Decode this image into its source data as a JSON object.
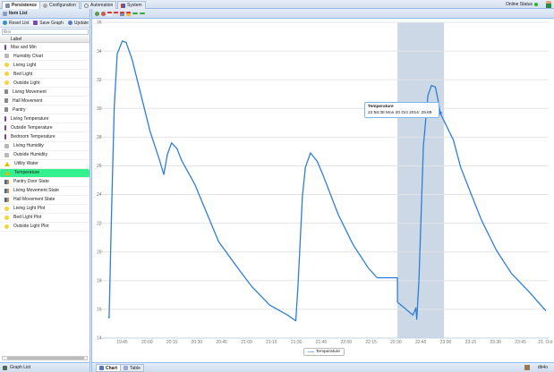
{
  "top_tabs": [
    {
      "label": "Persistence",
      "icon": "persistence-icon",
      "active": true
    },
    {
      "label": "Configuration",
      "icon": "gear-icon",
      "active": false
    },
    {
      "label": "Automation",
      "icon": "clock-icon",
      "active": false
    },
    {
      "label": "System",
      "icon": "system-icon",
      "active": false
    }
  ],
  "status": {
    "label": "Online Status",
    "color": "#22bb22"
  },
  "left_panel": {
    "title": "Item List",
    "toolbar": {
      "reset": "Reset List",
      "save": "Save Graph",
      "update": "Update"
    },
    "filter_placeholder": "filter",
    "column_header": "Label",
    "items": [
      {
        "label": "Max and Min",
        "icon": "thermo"
      },
      {
        "label": "Humidity Chart",
        "icon": "chart"
      },
      {
        "label": "Living Light",
        "icon": "bulb"
      },
      {
        "label": "Bed Light",
        "icon": "bulb"
      },
      {
        "label": "Outside Light",
        "icon": "bulb"
      },
      {
        "label": "Living Movement",
        "icon": "move"
      },
      {
        "label": "Hall Movement",
        "icon": "move"
      },
      {
        "label": "Pantry",
        "icon": "move"
      },
      {
        "label": "Living Temperature",
        "icon": "thermo"
      },
      {
        "label": "Outside Temperature",
        "icon": "thermo"
      },
      {
        "label": "Bedroom Temperature",
        "icon": "thermo"
      },
      {
        "label": "Living Humidity",
        "icon": "chart"
      },
      {
        "label": "Outside Humidity",
        "icon": "chart"
      },
      {
        "label": "Utility Water",
        "icon": "warn"
      },
      {
        "label": "Temperature",
        "icon": "warn",
        "selected": true
      },
      {
        "label": "Pantry Door State",
        "icon": "state"
      },
      {
        "label": "Living Movement State",
        "icon": "state"
      },
      {
        "label": "Hall Movement State",
        "icon": "state"
      },
      {
        "label": "Living Light Plot",
        "icon": "bulb"
      },
      {
        "label": "Bed Light Plot",
        "icon": "bulb"
      },
      {
        "label": "Outside Light Plot",
        "icon": "bulb"
      }
    ],
    "footer": "Graph List"
  },
  "bottom_tabs": [
    {
      "label": "Chart",
      "active": true
    },
    {
      "label": "Table",
      "active": false
    }
  ],
  "db_label": "db4o",
  "tooltip": {
    "title": "Temperature",
    "text": "22:56:38 Mon 20 Oct 2014: 29.69"
  },
  "chart_data": {
    "type": "line",
    "ylim": [
      14,
      36
    ],
    "yticks": [
      14,
      16,
      18,
      20,
      22,
      24,
      26,
      28,
      30,
      32,
      34,
      36
    ],
    "xlim": [
      "19:36:40",
      "00:02:00"
    ],
    "xticks": [
      "19:45",
      "20:00",
      "20:15",
      "20:30",
      "20:45",
      "21:00",
      "21:15",
      "21:30",
      "21:45",
      "22:00",
      "22:15",
      "22:30",
      "22:45",
      "23:00",
      "23:15",
      "23:30",
      "23:45",
      "21. Oct"
    ],
    "grid": true,
    "legend_position": "bottom-center",
    "color": "#2f7ed8",
    "highlight_band": [
      "22:30:53",
      "22:58:58"
    ],
    "series": [
      {
        "name": "Temperature",
        "points": [
          [
            "19:36:47",
            15.5
          ],
          [
            "19:37:10",
            15.4
          ],
          [
            "19:38:25",
            21.8
          ],
          [
            "19:40:15",
            30.1
          ],
          [
            "19:42:02",
            33.8
          ],
          [
            "19:45:06",
            34.7
          ],
          [
            "19:47:26",
            34.6
          ],
          [
            "19:51:03",
            33.4
          ],
          [
            "19:56:27",
            30.9
          ],
          [
            "20:01:51",
            28.4
          ],
          [
            "20:07:15",
            26.5
          ],
          [
            "20:10:07",
            25.4
          ],
          [
            "20:12:16",
            26.8
          ],
          [
            "20:14:49",
            27.6
          ],
          [
            "20:18:03",
            27.2
          ],
          [
            "20:20:45",
            26.4
          ],
          [
            "20:28:51",
            24.7
          ],
          [
            "20:37:49",
            22.2
          ],
          [
            "20:43:13",
            20.7
          ],
          [
            "20:55:51",
            18.7
          ],
          [
            "21:03:02",
            17.6
          ],
          [
            "21:13:50",
            16.3
          ],
          [
            "21:24:38",
            15.6
          ],
          [
            "21:29:39",
            15.2
          ],
          [
            "21:30:57",
            17.6
          ],
          [
            "21:33:39",
            23.9
          ],
          [
            "21:35:26",
            25.9
          ],
          [
            "21:38:31",
            26.9
          ],
          [
            "21:42:37",
            26.3
          ],
          [
            "21:46:14",
            25.3
          ],
          [
            "21:55:15",
            22.6
          ],
          [
            "22:04:13",
            20.5
          ],
          [
            "22:13:14",
            18.9
          ],
          [
            "22:18:38",
            18.2
          ],
          [
            "22:30:53",
            18.2
          ],
          [
            "22:30:56",
            16.5
          ],
          [
            "22:40:14",
            15.6
          ],
          [
            "22:42:01",
            16.1
          ],
          [
            "22:42:33",
            15.3
          ],
          [
            "22:43:51",
            18.0
          ],
          [
            "22:46:33",
            27.4
          ],
          [
            "22:49:15",
            30.9
          ],
          [
            "22:51:25",
            31.6
          ],
          [
            "22:53:44",
            31.5
          ],
          [
            "22:55:30",
            30.5
          ],
          [
            "22:56:38",
            29.69
          ],
          [
            "23:04:36",
            27.8
          ],
          [
            "23:09:00",
            25.9
          ],
          [
            "23:14:24",
            24.3
          ],
          [
            "23:21:36",
            22.2
          ],
          [
            "23:30:36",
            20.1
          ],
          [
            "23:39:36",
            18.5
          ],
          [
            "23:50:24",
            17.2
          ],
          [
            "00:00:18",
            15.9
          ]
        ]
      }
    ]
  }
}
